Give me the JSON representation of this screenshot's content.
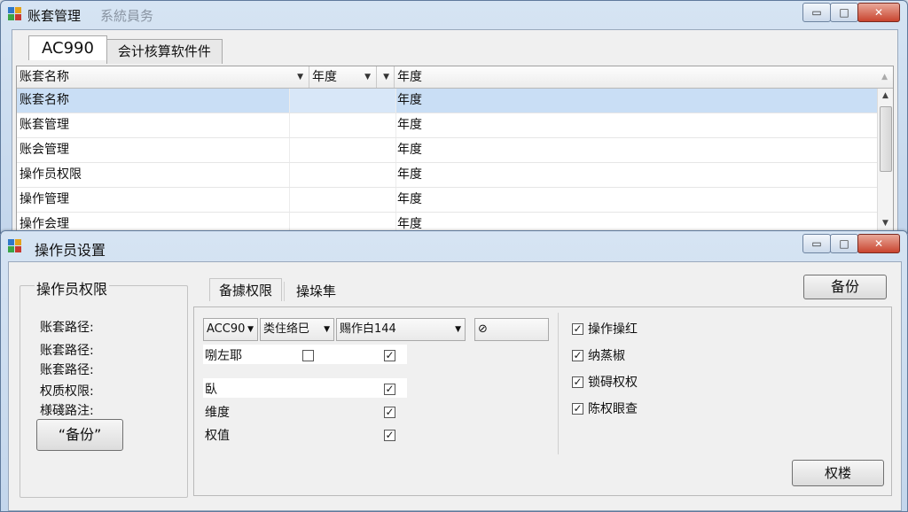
{
  "top_window": {
    "title": "账套管理",
    "subtitle": "系統員务",
    "controls": {
      "minimize": "▭",
      "maximize": "□",
      "close": "✕"
    },
    "tabs": [
      {
        "label": "AC990"
      },
      {
        "label": "会计核算软件件"
      }
    ],
    "grid": {
      "headers": [
        "账套名称",
        "年度",
        "年度"
      ],
      "rows": [
        {
          "name": "账套名称",
          "year": "年度",
          "selected": true
        },
        {
          "name": "账套管理",
          "year": "年度",
          "selected": false
        },
        {
          "name": "账会管理",
          "year": "年度",
          "selected": false
        },
        {
          "name": "操作员权限",
          "year": "年度",
          "selected": false
        },
        {
          "name": "操作管理",
          "year": "年度",
          "selected": false
        },
        {
          "name": "操作会理",
          "year": "年度",
          "selected": false
        }
      ]
    }
  },
  "bottom_window": {
    "title": "操作员设置",
    "controls": {
      "minimize": "▭",
      "maximize": "□",
      "close": "✕"
    },
    "left_group": {
      "title": "操作员权限",
      "labels": [
        "账套路径:",
        "账套路径:",
        "账套路径:",
        "权质权限:",
        "様碊路注:"
      ],
      "button": "“备份”"
    },
    "tabs": [
      {
        "label": "备據权限"
      },
      {
        "label": "操垛隼"
      }
    ],
    "top_button": "备份",
    "combos": [
      "ACC90",
      "类住络巳",
      "赐作白144"
    ],
    "small_combo": "⊘",
    "form_rows": [
      {
        "label": "哵左耶",
        "checked": false,
        "checked2": true
      },
      {
        "label": "臥",
        "checked": true
      },
      {
        "label": "维度",
        "checked": true
      },
      {
        "label": "权值",
        "checked": true
      }
    ],
    "right_checks": [
      {
        "label": "操作操红",
        "checked": true
      },
      {
        "label": "纳蒸椒",
        "checked": true
      },
      {
        "label": "锁碍权权",
        "checked": true
      },
      {
        "label": "陈权眼查",
        "checked": true
      }
    ],
    "bottom_button": "权楼"
  }
}
